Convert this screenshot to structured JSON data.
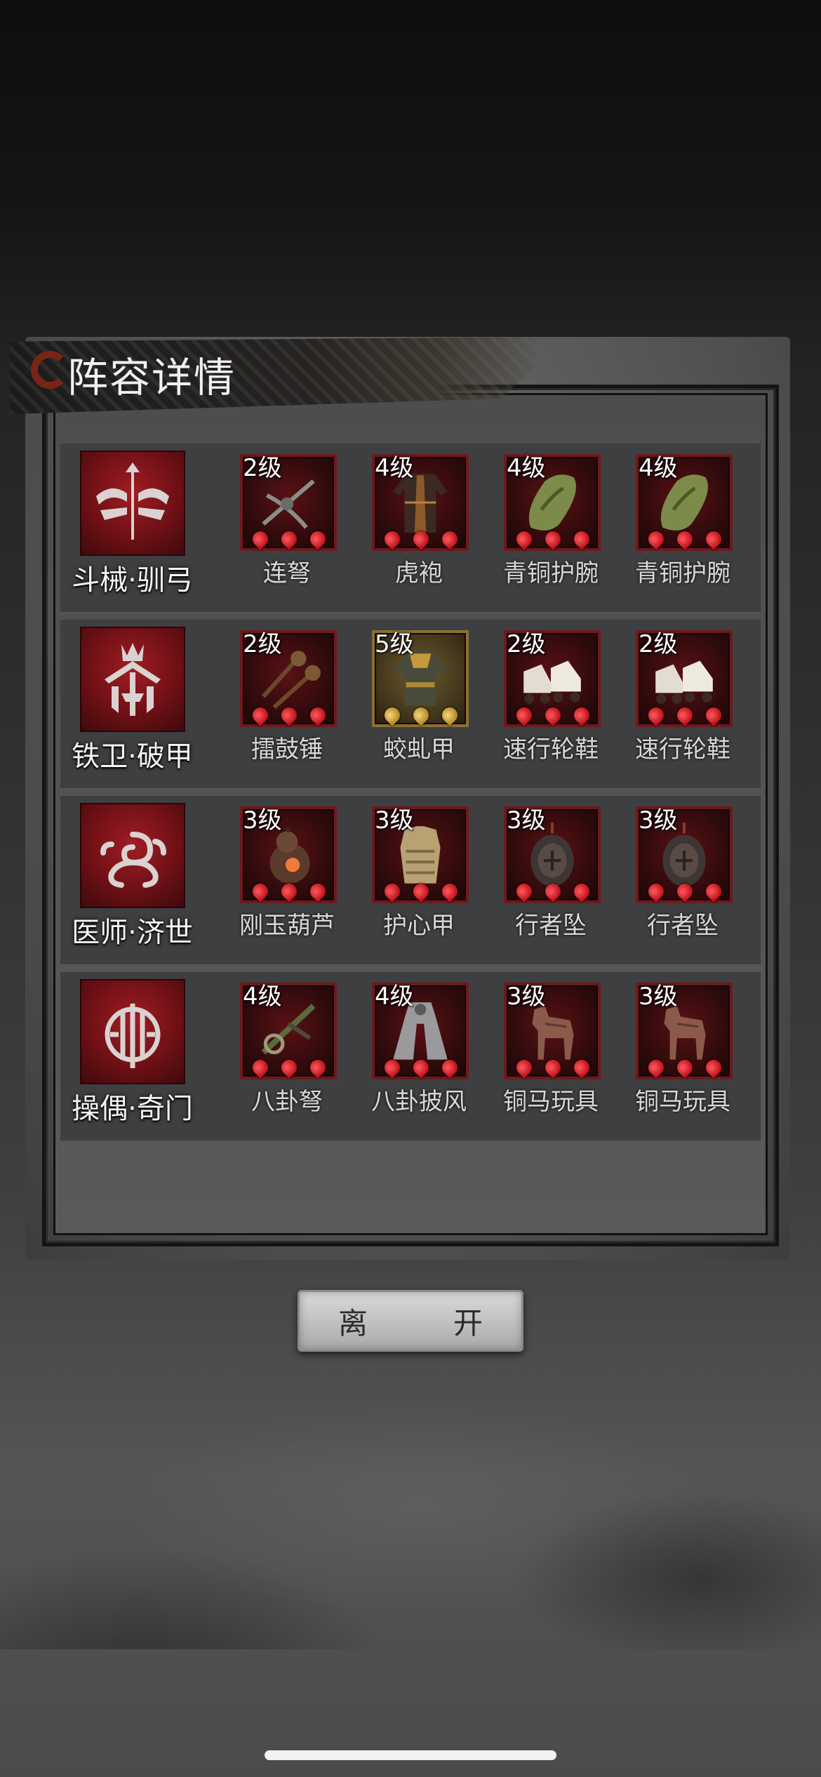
{
  "title": "阵容详情",
  "leave_button": "离　开",
  "rows": [
    {
      "role": "斗械·驯弓",
      "role_icon": "bow-emblem-icon",
      "items": [
        {
          "level": "2级",
          "name": "连弩",
          "icon": "repeating-crossbow-icon",
          "pip_color": "red"
        },
        {
          "level": "4级",
          "name": "虎袍",
          "icon": "tiger-robe-icon",
          "pip_color": "red"
        },
        {
          "level": "4级",
          "name": "青铜护腕",
          "icon": "bronze-bracer-icon",
          "pip_color": "red"
        },
        {
          "level": "4级",
          "name": "青铜护腕",
          "icon": "bronze-bracer-icon",
          "pip_color": "red"
        }
      ]
    },
    {
      "role": "铁卫·破甲",
      "role_icon": "crown-shield-emblem-icon",
      "items": [
        {
          "level": "2级",
          "name": "擂鼓锤",
          "icon": "drum-hammers-icon",
          "pip_color": "red"
        },
        {
          "level": "5级",
          "name": "蛟虬甲",
          "icon": "dragon-armor-icon",
          "pip_color": "gold"
        },
        {
          "level": "2级",
          "name": "速行轮鞋",
          "icon": "wheeled-shoes-icon",
          "pip_color": "red"
        },
        {
          "level": "2级",
          "name": "速行轮鞋",
          "icon": "wheeled-shoes-icon",
          "pip_color": "red"
        }
      ]
    },
    {
      "role": "医师·济世",
      "role_icon": "cloud-swirl-emblem-icon",
      "items": [
        {
          "level": "3级",
          "name": "刚玉葫芦",
          "icon": "gourd-icon",
          "pip_color": "red"
        },
        {
          "level": "3级",
          "name": "护心甲",
          "icon": "chest-armor-icon",
          "pip_color": "red"
        },
        {
          "level": "3级",
          "name": "行者坠",
          "icon": "pendant-icon",
          "pip_color": "red"
        },
        {
          "level": "3级",
          "name": "行者坠",
          "icon": "pendant-icon",
          "pip_color": "red"
        }
      ]
    },
    {
      "role": "操偶·奇门",
      "role_icon": "puppet-gear-emblem-icon",
      "items": [
        {
          "level": "4级",
          "name": "八卦弩",
          "icon": "bagua-crossbow-icon",
          "pip_color": "red"
        },
        {
          "level": "4级",
          "name": "八卦披风",
          "icon": "bagua-cloak-icon",
          "pip_color": "red"
        },
        {
          "level": "3级",
          "name": "铜马玩具",
          "icon": "bronze-horse-icon",
          "pip_color": "red"
        },
        {
          "level": "3级",
          "name": "铜马玩具",
          "icon": "bronze-horse-icon",
          "pip_color": "red"
        }
      ]
    }
  ]
}
